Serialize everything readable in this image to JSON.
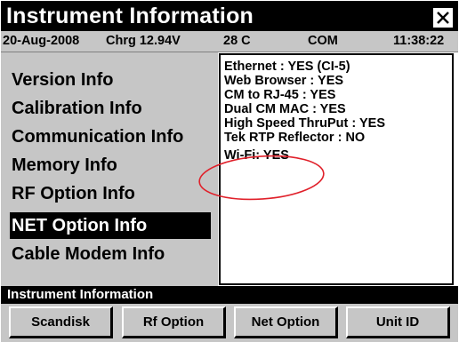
{
  "window": {
    "title": "Instrument Information"
  },
  "status": {
    "date": "20-Aug-2008",
    "charge": "Chrg 12.94V",
    "temperature": "28 C",
    "port": "COM",
    "time": "11:38:22"
  },
  "menu": {
    "items": [
      {
        "label": "Version Info",
        "selected": false
      },
      {
        "label": "Calibration Info",
        "selected": false
      },
      {
        "label": "Communication Info",
        "selected": false
      },
      {
        "label": "Memory Info",
        "selected": false
      },
      {
        "label": "RF Option Info",
        "selected": false
      },
      {
        "label": "NET Option Info",
        "selected": true
      },
      {
        "label": "Cable Modem Info",
        "selected": false
      }
    ]
  },
  "details": {
    "lines": [
      "Ethernet : YES (CI-5)",
      "Web Browser : YES",
      "CM to RJ-45 : YES",
      "Dual CM MAC : YES",
      "High Speed ThruPut : YES",
      "Tek RTP Reflector : NO",
      "Wi-Fi: YES"
    ]
  },
  "annotation": {
    "color": "#e0202a",
    "target": "Wi-Fi: YES"
  },
  "section": {
    "label": "Instrument Information"
  },
  "softkeys": [
    {
      "label": "Scandisk"
    },
    {
      "label": "Rf Option"
    },
    {
      "label": "Net Option"
    },
    {
      "label": "Unit ID"
    }
  ],
  "colors": {
    "panel": "#c6c6c6",
    "bar": "#000000",
    "highlight_text": "#ffffff"
  }
}
